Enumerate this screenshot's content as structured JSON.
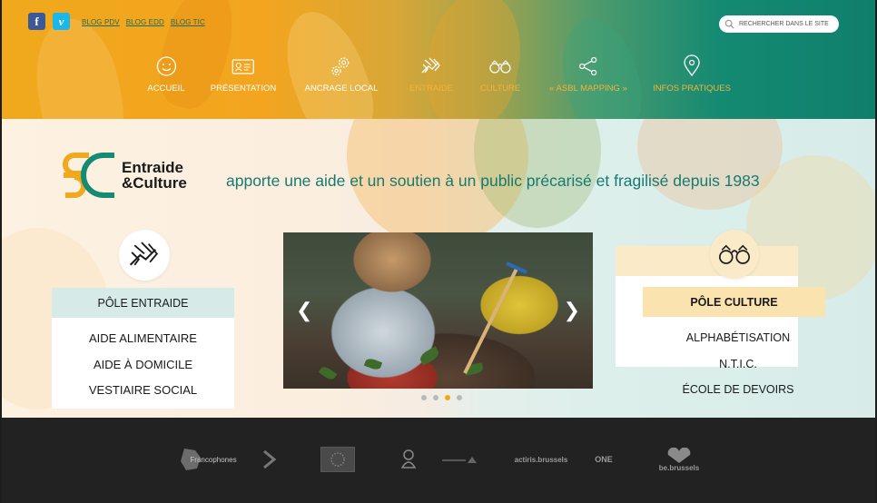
{
  "social": {
    "facebook": "f",
    "vimeo": "v"
  },
  "blogs": [
    "BLOG PDV",
    "BLOG EDD",
    "BLOG TIC"
  ],
  "search": {
    "placeholder": "RECHERCHER DANS LE SITE"
  },
  "nav": [
    {
      "label": "ACCUEIL",
      "icon": "smiley-icon",
      "active": false
    },
    {
      "label": "PRÉSENTATION",
      "icon": "id-card-icon",
      "active": false
    },
    {
      "label": "ANCRAGE LOCAL",
      "icon": "gears-icon",
      "active": false
    },
    {
      "label": "ENTRAIDE",
      "icon": "handshake-icon",
      "active": true
    },
    {
      "label": "CULTURE",
      "icon": "binoculars-icon",
      "active": true
    },
    {
      "label": "« ASBL MAPPING »",
      "icon": "share-icon",
      "active": true
    },
    {
      "label": "INFOS PRATIQUES",
      "icon": "location-pin-icon",
      "active": true
    }
  ],
  "logo": {
    "line1": "Entraide",
    "line2": "&Culture"
  },
  "tagline": "apporte une aide et un soutien à un public précarisé et fragilisé depuis 1983",
  "pole_entraide": {
    "title": "PÔLE ENTRAIDE",
    "items": [
      "AIDE ALIMENTAIRE",
      "AIDE À DOMICILE",
      "VESTIAIRE SOCIAL"
    ]
  },
  "pole_culture": {
    "title": "PÔLE CULTURE",
    "items": [
      "ALPHABÉTISATION",
      "N.T.I.C.",
      "ÉCOLE DE DEVOIRS"
    ]
  },
  "slider": {
    "prev": "❮",
    "next": "❯",
    "slide_count": 4,
    "active_slide": 3
  },
  "partners": [
    {
      "name": "francophones-logo",
      "text": "Francophones"
    },
    {
      "name": "arrow-logo",
      "text": ""
    },
    {
      "name": "eu-flag-logo",
      "text": ""
    },
    {
      "name": "chick-logo",
      "text": ""
    },
    {
      "name": "cocof-logo",
      "text": ""
    },
    {
      "name": "actiris-logo",
      "text": "actiris.brussels"
    },
    {
      "name": "one-logo",
      "text": "ONE"
    },
    {
      "name": "be-brussels-logo",
      "text": "be.brussels"
    }
  ],
  "colors": {
    "orange": "#f0a81c",
    "teal": "#0f7f6c",
    "tagline": "#167a70",
    "footer": "#222222"
  }
}
